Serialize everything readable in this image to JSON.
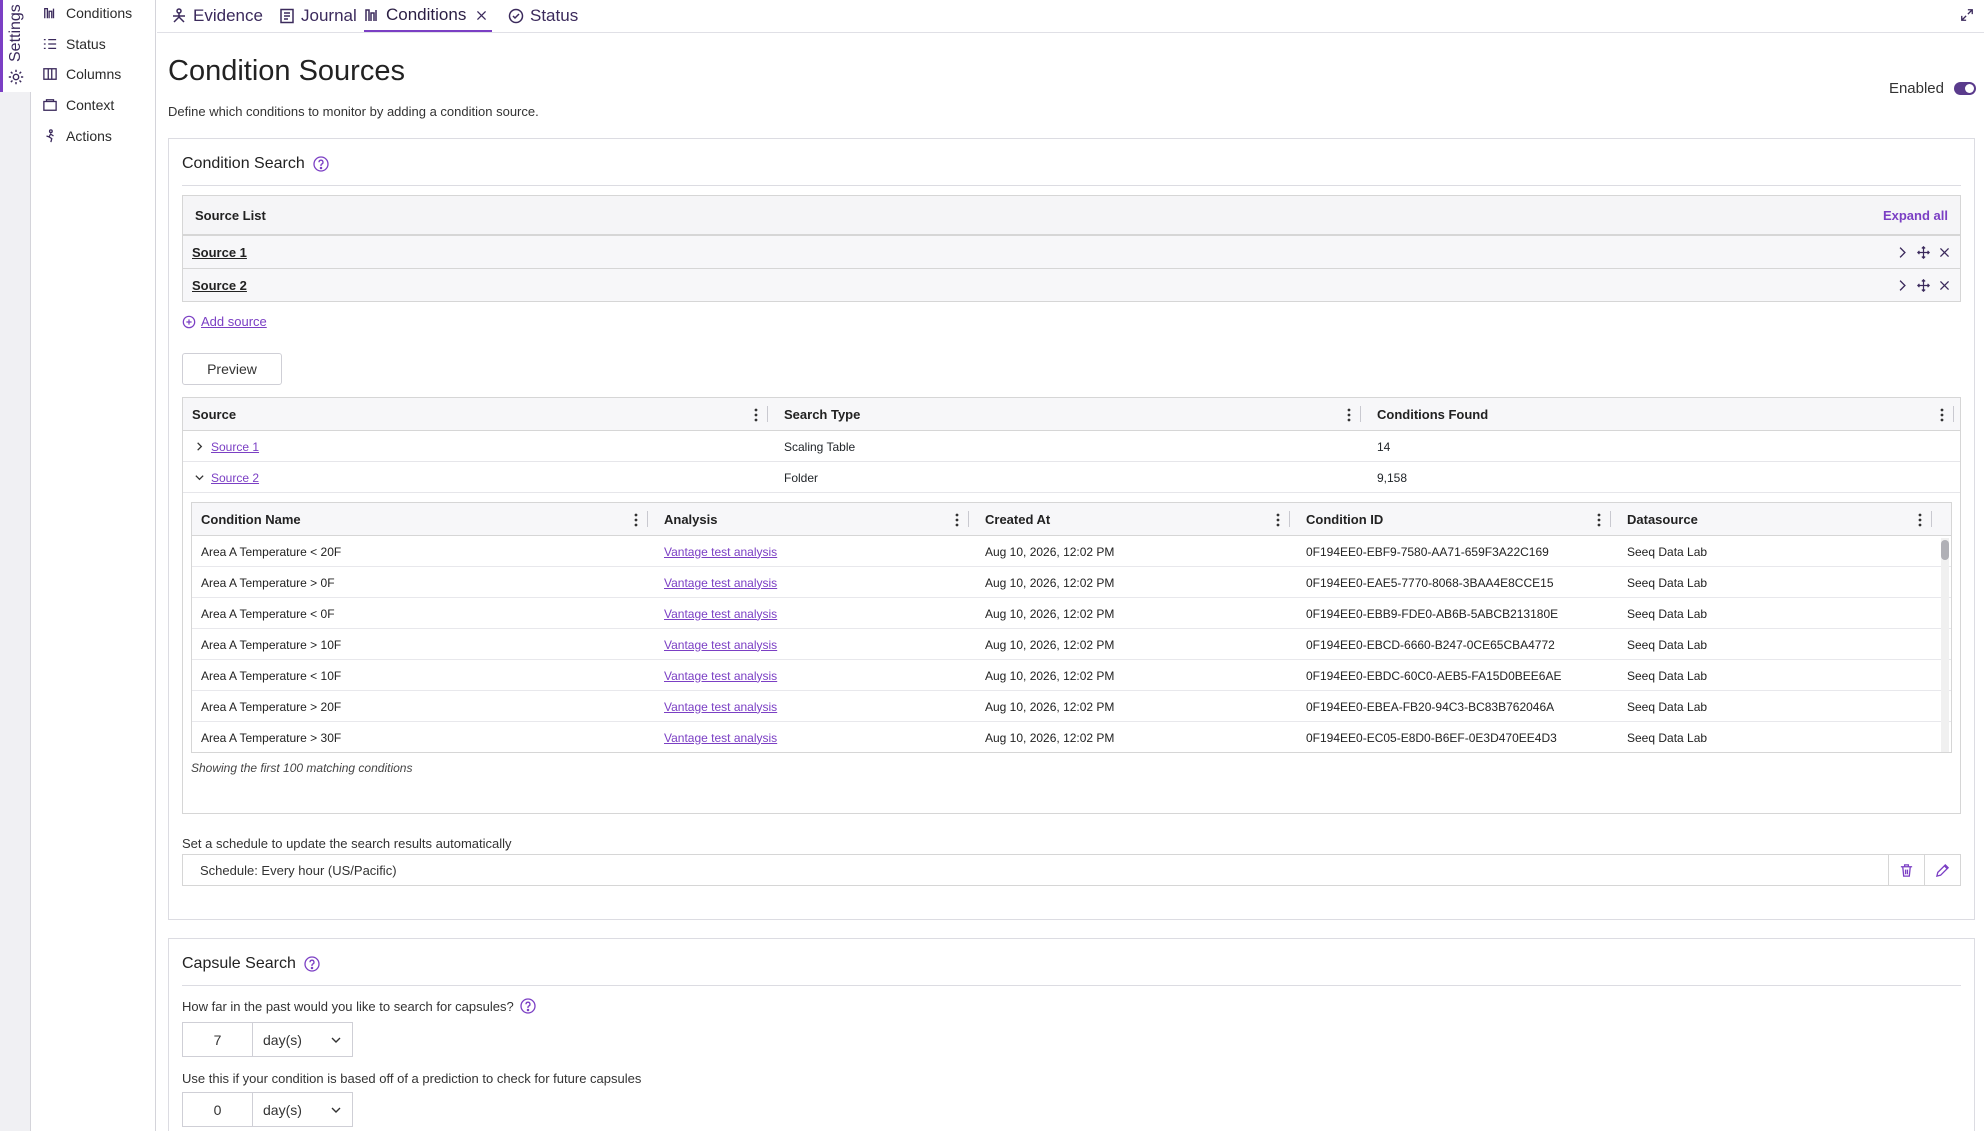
{
  "rail": {
    "label": "Settings",
    "icon": "gear-icon"
  },
  "settings_nav": [
    {
      "label": "Conditions",
      "icon": "conditions-icon"
    },
    {
      "label": "Status",
      "icon": "list-icon"
    },
    {
      "label": "Columns",
      "icon": "columns-icon"
    },
    {
      "label": "Context",
      "icon": "context-icon"
    },
    {
      "label": "Actions",
      "icon": "actions-icon"
    }
  ],
  "tabs": [
    {
      "label": "Evidence",
      "icon": "evidence-icon"
    },
    {
      "label": "Journal",
      "icon": "journal-icon"
    },
    {
      "label": "Conditions",
      "icon": "conditions-icon",
      "active": true
    },
    {
      "label": "Status",
      "icon": "check-circle-icon"
    }
  ],
  "page": {
    "title": "Condition Sources",
    "description": "Define which conditions to monitor by adding a condition source.",
    "enabled_label": "Enabled",
    "enabled": true
  },
  "condition_search": {
    "title": "Condition Search",
    "source_list": {
      "title": "Source List",
      "expand_all": "Expand all",
      "items": [
        "Source 1",
        "Source 2"
      ]
    },
    "add_source": "Add source",
    "preview_button": "Preview",
    "preview_table": {
      "columns": [
        "Source",
        "Search Type",
        "Conditions Found"
      ],
      "rows": [
        {
          "source": "Source 1",
          "search_type": "Scaling Table",
          "found": "14",
          "expanded": false
        },
        {
          "source": "Source 2",
          "search_type": "Folder",
          "found": "9,158",
          "expanded": true
        }
      ]
    },
    "conditions_table": {
      "columns": [
        "Condition Name",
        "Analysis",
        "Created At",
        "Condition ID",
        "Datasource"
      ],
      "rows": [
        [
          "Area A Temperature < 20F",
          "Vantage test analysis",
          "Aug 10, 2026, 12:02 PM",
          "0F194EE0-EBF9-7580-AA71-659F3A22C169",
          "Seeq Data Lab"
        ],
        [
          "Area A Temperature > 0F",
          "Vantage test analysis",
          "Aug 10, 2026, 12:02 PM",
          "0F194EE0-EAE5-7770-8068-3BAA4E8CCE15",
          "Seeq Data Lab"
        ],
        [
          "Area A Temperature < 0F",
          "Vantage test analysis",
          "Aug 10, 2026, 12:02 PM",
          "0F194EE0-EBB9-FDE0-AB6B-5ABCB213180E",
          "Seeq Data Lab"
        ],
        [
          "Area A Temperature > 10F",
          "Vantage test analysis",
          "Aug 10, 2026, 12:02 PM",
          "0F194EE0-EBCD-6660-B247-0CE65CBA4772",
          "Seeq Data Lab"
        ],
        [
          "Area A Temperature < 10F",
          "Vantage test analysis",
          "Aug 10, 2026, 12:02 PM",
          "0F194EE0-EBDC-60C0-AEB5-FA15D0BEE6AE",
          "Seeq Data Lab"
        ],
        [
          "Area A Temperature > 20F",
          "Vantage test analysis",
          "Aug 10, 2026, 12:02 PM",
          "0F194EE0-EBEA-FB20-94C3-BC83B762046A",
          "Seeq Data Lab"
        ],
        [
          "Area A Temperature > 30F",
          "Vantage test analysis",
          "Aug 10, 2026, 12:02 PM",
          "0F194EE0-EC05-E8D0-B6EF-0E3D470EE4D3",
          "Seeq Data Lab"
        ]
      ],
      "footnote": "Showing the first 100 matching conditions"
    },
    "schedule_label": "Set a schedule to update the search results automatically",
    "schedule_value": "Schedule: Every hour (US/Pacific)"
  },
  "capsule_search": {
    "title": "Capsule Search",
    "past_label": "How far in the past would you like to search for capsules?",
    "past_value": "7",
    "past_unit": "day(s)",
    "future_label": "Use this if your condition is based off of a prediction to check for future capsules",
    "future_value": "0",
    "future_unit": "day(s)"
  },
  "colors": {
    "accent": "#7b3fc4",
    "dark": "#3b2a5c"
  }
}
